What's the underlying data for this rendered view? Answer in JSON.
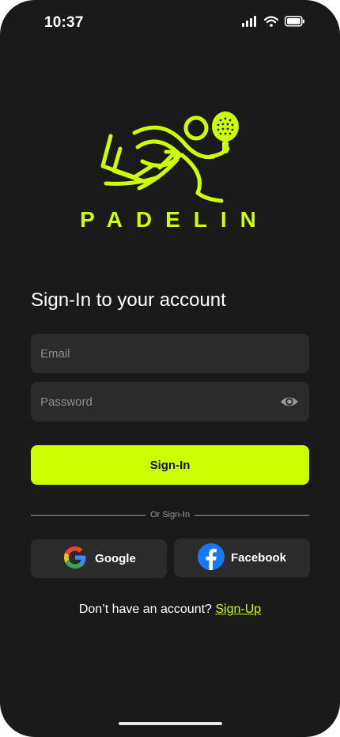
{
  "status_bar": {
    "time": "10:37"
  },
  "brand": {
    "name": "PADELIN"
  },
  "signin": {
    "title": "Sign-In to your account",
    "email_placeholder": "Email",
    "password_placeholder": "Password",
    "button_label": "Sign-In",
    "divider_text": "Or Sign-In"
  },
  "social": {
    "google_label": "Google",
    "facebook_label": "Facebook"
  },
  "signup": {
    "prompt": "Don’t have an account? ",
    "link_label": "Sign-Up"
  },
  "colors": {
    "accent": "#cdff00",
    "background": "#1a1a1a",
    "field": "#2b2b2b"
  },
  "icons": [
    "signal-icon",
    "wifi-icon",
    "battery-icon",
    "eye-icon",
    "google-icon",
    "facebook-icon"
  ]
}
